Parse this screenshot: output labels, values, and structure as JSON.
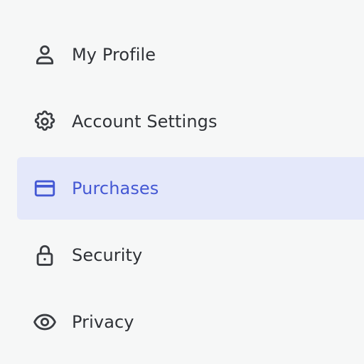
{
  "sidebar": {
    "active_index": 2,
    "accent_color": "#4458d4",
    "active_background": "#e4e8fa",
    "items": [
      {
        "label": "My Profile",
        "icon": "person-icon"
      },
      {
        "label": "Account Settings",
        "icon": "gear-icon"
      },
      {
        "label": "Purchases",
        "icon": "credit-card-icon"
      },
      {
        "label": "Security",
        "icon": "lock-icon"
      },
      {
        "label": "Privacy",
        "icon": "eye-icon"
      }
    ]
  }
}
